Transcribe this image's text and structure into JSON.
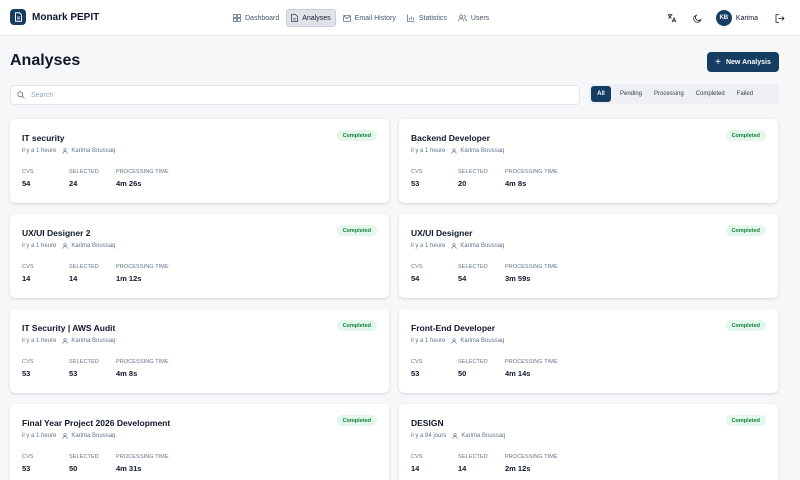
{
  "app": {
    "name": "Monark PEPIT"
  },
  "nav": {
    "items": [
      {
        "label": "Dashboard",
        "icon": "dashboard-icon",
        "active": false
      },
      {
        "label": "Analyses",
        "icon": "document-icon",
        "active": true
      },
      {
        "label": "Email History",
        "icon": "mail-icon",
        "active": false
      },
      {
        "label": "Statistics",
        "icon": "chart-icon",
        "active": false
      },
      {
        "label": "Users",
        "icon": "users-icon",
        "active": false
      }
    ]
  },
  "user": {
    "initials": "KB",
    "name": "Karima"
  },
  "page": {
    "title": "Analyses",
    "new_button": "New Analysis",
    "search_placeholder": "Search",
    "filters": [
      "All",
      "Pending",
      "Processing",
      "Completed",
      "Failed"
    ],
    "active_filter": "All"
  },
  "stat_labels": {
    "cvs": "CVS",
    "selected": "SELECTED",
    "processing_time": "PROCESSING TIME"
  },
  "analyses": [
    {
      "title": "IT security",
      "time": "il y a 1 heure",
      "author": "Karima Boussaq",
      "status": "Completed",
      "cvs": "54",
      "selected": "24",
      "processing_time": "4m 26s"
    },
    {
      "title": "Backend Developer",
      "time": "il y a 1 heure",
      "author": "Karima Boussaq",
      "status": "Completed",
      "cvs": "53",
      "selected": "20",
      "processing_time": "4m 8s"
    },
    {
      "title": "UX/UI Designer 2",
      "time": "il y a 1 heure",
      "author": "Karima Boussaq",
      "status": "Completed",
      "cvs": "14",
      "selected": "14",
      "processing_time": "1m 12s"
    },
    {
      "title": "UX/UI Designer",
      "time": "il y a 1 heure",
      "author": "Karima Boussaq",
      "status": "Completed",
      "cvs": "54",
      "selected": "54",
      "processing_time": "3m 59s"
    },
    {
      "title": "IT Security | AWS Audit",
      "time": "il y a 1 heure",
      "author": "Karima Boussaq",
      "status": "Completed",
      "cvs": "53",
      "selected": "53",
      "processing_time": "4m 8s"
    },
    {
      "title": "Front-End Developer",
      "time": "il y a 1 heure",
      "author": "Karima Boussaq",
      "status": "Completed",
      "cvs": "53",
      "selected": "50",
      "processing_time": "4m 14s"
    },
    {
      "title": "Final Year Project 2026 Development",
      "time": "il y a 1 heure",
      "author": "Karima Boussaq",
      "status": "Completed",
      "cvs": "53",
      "selected": "50",
      "processing_time": "4m 31s"
    },
    {
      "title": "DESIGN",
      "time": "il y a 84 jours",
      "author": "Karima Boussaq",
      "status": "Completed",
      "cvs": "14",
      "selected": "14",
      "processing_time": "2m 12s"
    }
  ],
  "colors": {
    "primary": "#163e63",
    "status_completed_bg": "#e3f7ec",
    "status_completed_text": "#15803d"
  }
}
